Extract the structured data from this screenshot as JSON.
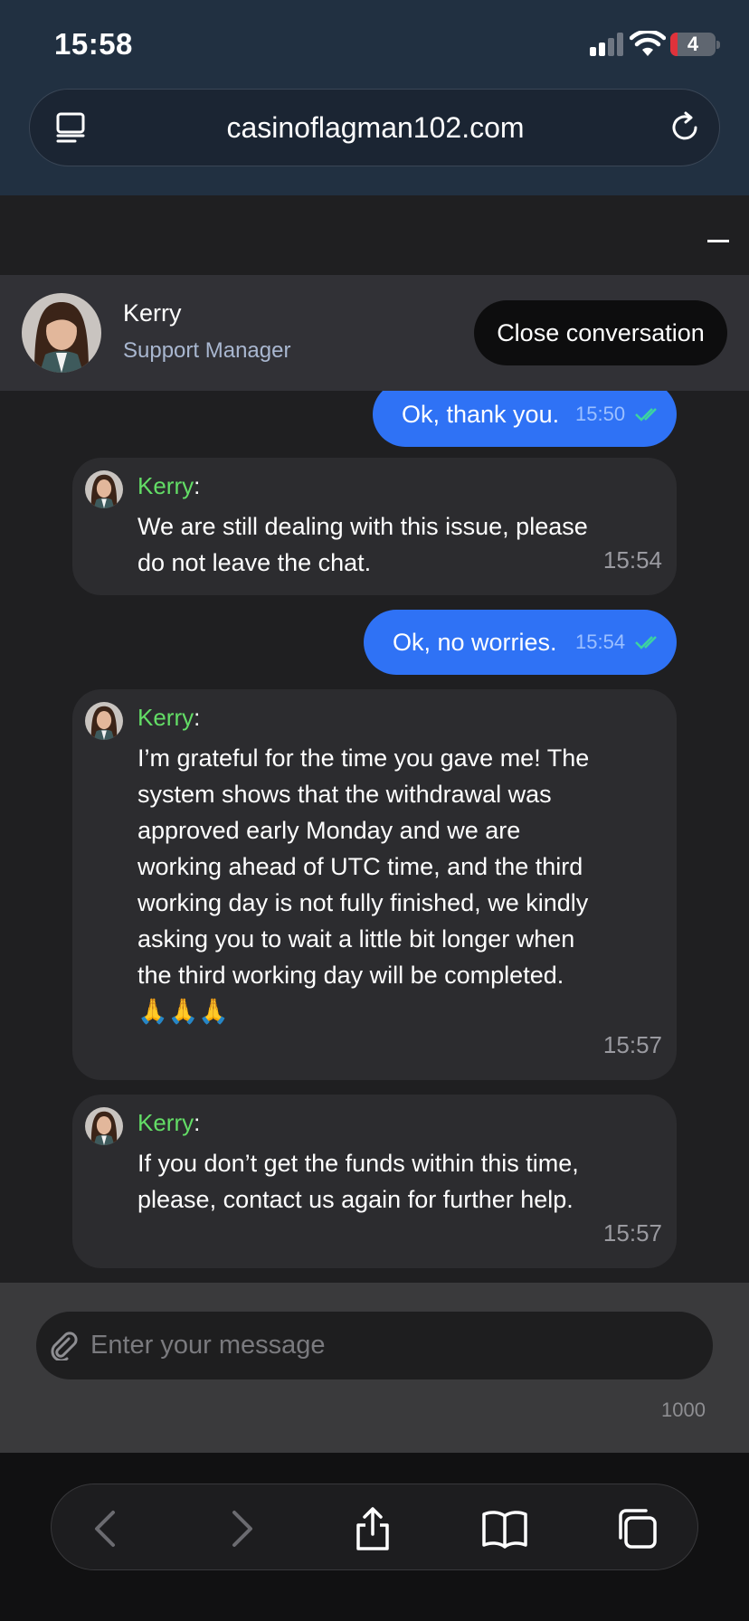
{
  "status": {
    "time": "15:58",
    "battery": "4"
  },
  "browser": {
    "url": "casinoflagman102.com"
  },
  "chat_header": {
    "agent_name": "Kerry",
    "agent_role": "Support Manager",
    "close_label": "Close conversation"
  },
  "messages": [
    {
      "dir": "out",
      "text": "Ok, thank you.",
      "time": "15:50"
    },
    {
      "dir": "in",
      "sender": "Kerry",
      "text": "We are still dealing with this issue, please do not leave the chat.",
      "time": "15:54"
    },
    {
      "dir": "out",
      "text": "Ok, no worries.",
      "time": "15:54"
    },
    {
      "dir": "in",
      "sender": "Kerry",
      "text": "I’m grateful for the time you gave me! The system shows that the withdrawal was approved early Monday and we are working ahead of UTC time, and the third working day is not fully finished, we kindly asking you to wait a little bit longer when the third working day will be completed. 🙏🙏🙏",
      "time": "15:57"
    },
    {
      "dir": "in",
      "sender": "Kerry",
      "text": "If you don’t get the funds within this time, please, contact us again for further help.",
      "time": "15:57"
    }
  ],
  "composer": {
    "placeholder": "Enter your message",
    "char_limit": "1000"
  },
  "colors": {
    "outgoing_bubble": "#2f72f5",
    "incoming_bubble": "#2c2c2f",
    "sender_name": "#63dd66"
  }
}
